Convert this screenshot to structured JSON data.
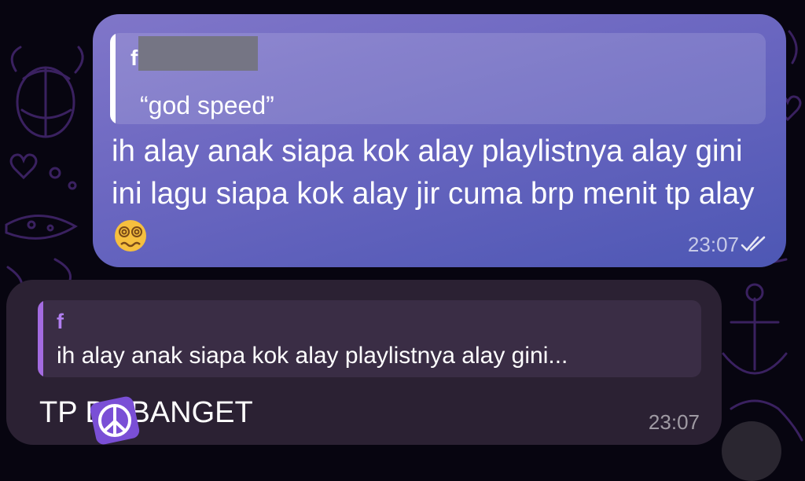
{
  "outgoing_message": {
    "reply_preview": {
      "sender_name": "f h",
      "quoted_text": "“god speed”"
    },
    "text": "ih alay anak siapa kok alay playlistnya alay gini ini lagu siapa kok alay jir cuma brp menit tp alay",
    "emoji": "woozy-dizzy-face-emoji",
    "time": "23:07",
    "status_icon": "double-check-icon"
  },
  "incoming_message": {
    "reply_preview": {
      "sender_name": "f",
      "quoted_text": "ih alay anak siapa kok alay playlistnya alay gini..."
    },
    "text": "TP B I BANGET",
    "time": "23:07"
  },
  "colors": {
    "background": "#070510",
    "outgoing_bubble": "#6a66c0",
    "incoming_bubble": "#2b2133",
    "incoming_accent": "#a36be0",
    "wallpaper_doodle": "#3a2160"
  },
  "overlay_icons": [
    "peace-sign-icon",
    "scroll-down-button"
  ]
}
